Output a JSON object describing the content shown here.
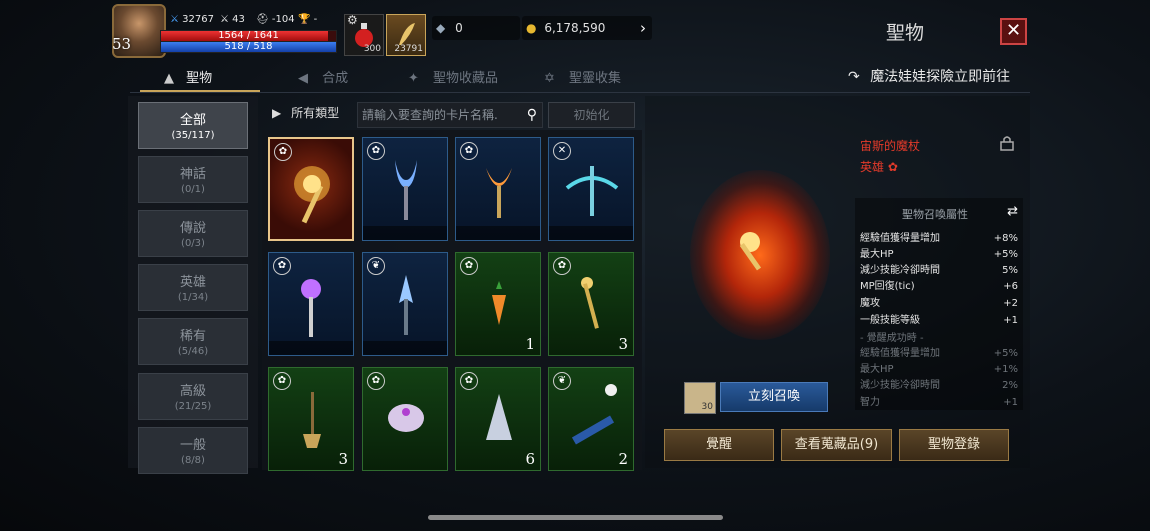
{
  "player": {
    "level": "53",
    "power": "32767",
    "stat2": "43",
    "stat3": "-104",
    "stat4": "-",
    "hp": "1564 / 1641",
    "mp": "518 / 518",
    "hp_ratio": 0.953,
    "mp_ratio": 1.0
  },
  "quick_slots": {
    "potion_count": "300",
    "scroll_count": "23791"
  },
  "currency": {
    "gems": "0",
    "gold": "6,178,590"
  },
  "window": {
    "title": "聖物"
  },
  "tabs": [
    {
      "label": "聖物"
    },
    {
      "label": "合成"
    },
    {
      "label": "聖物收藏品"
    },
    {
      "label": "聖靈收集"
    }
  ],
  "goto_link": "魔法娃娃探險立即前往",
  "categories": [
    {
      "name": "全部",
      "count": "(35/117)"
    },
    {
      "name": "神話",
      "count": "(0/1)"
    },
    {
      "name": "傳說",
      "count": "(0/3)"
    },
    {
      "name": "英雄",
      "count": "(1/34)"
    },
    {
      "name": "稀有",
      "count": "(5/46)"
    },
    {
      "name": "高級",
      "count": "(21/25)"
    },
    {
      "name": "一般",
      "count": "(8/8)"
    }
  ],
  "filter": {
    "type_label": "所有類型",
    "search_placeholder": "請輸入要查詢的卡片名稱.",
    "reset_label": "初始化"
  },
  "cards": [
    {
      "count": ""
    },
    {
      "count": ""
    },
    {
      "count": ""
    },
    {
      "count": ""
    },
    {
      "count": ""
    },
    {
      "count": ""
    },
    {
      "count": "1"
    },
    {
      "count": "3"
    },
    {
      "count": "3"
    },
    {
      "count": ""
    },
    {
      "count": "6"
    },
    {
      "count": "2"
    }
  ],
  "detail": {
    "item_name": "宙斯的魔杖",
    "item_grade": "英雄",
    "attr_header": "聖物召喚屬性",
    "attrs": [
      {
        "k": "經驗值獲得量增加",
        "v": "+8%"
      },
      {
        "k": "最大HP",
        "v": "+5%"
      },
      {
        "k": "減少技能冷卻時間",
        "v": "5%"
      },
      {
        "k": "MP回復(tic)",
        "v": "+6"
      },
      {
        "k": "魔攻",
        "v": "+2"
      },
      {
        "k": "一般技能等級",
        "v": "+1"
      }
    ],
    "awaken_header": "- 覺醒成功時 -",
    "awaken_attrs": [
      {
        "k": "經驗值獲得量增加",
        "v": "+5%"
      },
      {
        "k": "最大HP",
        "v": "+1%"
      },
      {
        "k": "減少技能冷卻時間",
        "v": "2%"
      },
      {
        "k": "智力",
        "v": "+1"
      }
    ],
    "summon_item_count": "30",
    "summon_label": "立刻召喚",
    "btn_awaken": "覺醒",
    "btn_view": "查看蒐藏品(9)",
    "btn_register": "聖物登錄"
  }
}
